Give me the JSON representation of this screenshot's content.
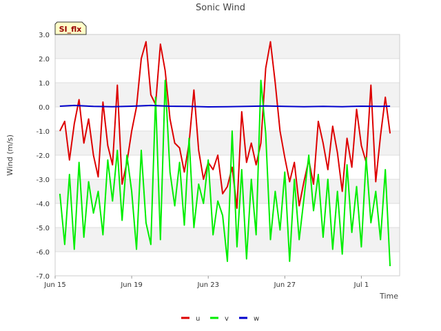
{
  "chart_data": {
    "type": "line",
    "title": "Sonic Wind",
    "xlabel": "Time",
    "ylabel": "Wind (m/s)",
    "badge": "SI_flx",
    "ylim": [
      -7.0,
      3.0
    ],
    "y_ticks": [
      "3.0",
      "2.0",
      "1.0",
      "0.0",
      "-1.0",
      "-2.0",
      "-3.0",
      "-4.0",
      "-5.0",
      "-6.0",
      "-7.0"
    ],
    "xlim": [
      "2023-06-15",
      "2023-07-03"
    ],
    "x_ticks": [
      {
        "date": "2023-06-15",
        "label": "Jun 15"
      },
      {
        "date": "2023-06-19",
        "label": "Jun 19"
      },
      {
        "date": "2023-06-23",
        "label": "Jun 23"
      },
      {
        "date": "2023-06-27",
        "label": "Jun 27"
      },
      {
        "date": "2023-07-01",
        "label": "Jul 1"
      }
    ],
    "grid": true,
    "legend_position": "bottom",
    "series": [
      {
        "name": "u",
        "color": "#dd0000",
        "points": [
          [
            "2023-06-15 06:00",
            -1.0
          ],
          [
            "2023-06-15 12:00",
            -0.6
          ],
          [
            "2023-06-15 18:00",
            -2.2
          ],
          [
            "2023-06-16 00:00",
            -0.7
          ],
          [
            "2023-06-16 06:00",
            0.3
          ],
          [
            "2023-06-16 12:00",
            -1.5
          ],
          [
            "2023-06-16 18:00",
            -0.5
          ],
          [
            "2023-06-17 00:00",
            -2.0
          ],
          [
            "2023-06-17 06:00",
            -2.9
          ],
          [
            "2023-06-17 12:00",
            0.2
          ],
          [
            "2023-06-17 18:00",
            -1.6
          ],
          [
            "2023-06-18 00:00",
            -2.4
          ],
          [
            "2023-06-18 06:00",
            0.9
          ],
          [
            "2023-06-18 12:00",
            -3.2
          ],
          [
            "2023-06-18 18:00",
            -2.3
          ],
          [
            "2023-06-19 00:00",
            -1.0
          ],
          [
            "2023-06-19 06:00",
            0.0
          ],
          [
            "2023-06-19 12:00",
            2.0
          ],
          [
            "2023-06-19 18:00",
            2.7
          ],
          [
            "2023-06-20 00:00",
            0.5
          ],
          [
            "2023-06-20 06:00",
            0.1
          ],
          [
            "2023-06-20 12:00",
            2.6
          ],
          [
            "2023-06-20 18:00",
            1.5
          ],
          [
            "2023-06-21 00:00",
            -0.5
          ],
          [
            "2023-06-21 06:00",
            -1.5
          ],
          [
            "2023-06-21 12:00",
            -1.7
          ],
          [
            "2023-06-21 18:00",
            -2.7
          ],
          [
            "2023-06-22 00:00",
            -1.5
          ],
          [
            "2023-06-22 06:00",
            0.7
          ],
          [
            "2023-06-22 12:00",
            -1.8
          ],
          [
            "2023-06-22 18:00",
            -3.0
          ],
          [
            "2023-06-23 00:00",
            -2.3
          ],
          [
            "2023-06-23 06:00",
            -2.6
          ],
          [
            "2023-06-23 12:00",
            -2.0
          ],
          [
            "2023-06-23 18:00",
            -3.6
          ],
          [
            "2023-06-24 00:00",
            -3.3
          ],
          [
            "2023-06-24 06:00",
            -2.5
          ],
          [
            "2023-06-24 12:00",
            -4.2
          ],
          [
            "2023-06-24 18:00",
            -0.2
          ],
          [
            "2023-06-25 00:00",
            -2.3
          ],
          [
            "2023-06-25 06:00",
            -1.5
          ],
          [
            "2023-06-25 12:00",
            -2.4
          ],
          [
            "2023-06-25 18:00",
            -1.5
          ],
          [
            "2023-06-26 00:00",
            1.6
          ],
          [
            "2023-06-26 06:00",
            2.7
          ],
          [
            "2023-06-26 12:00",
            1.0
          ],
          [
            "2023-06-26 18:00",
            -1.0
          ],
          [
            "2023-06-27 00:00",
            -2.1
          ],
          [
            "2023-06-27 06:00",
            -3.1
          ],
          [
            "2023-06-27 12:00",
            -2.3
          ],
          [
            "2023-06-27 18:00",
            -4.1
          ],
          [
            "2023-06-28 00:00",
            -3.1
          ],
          [
            "2023-06-28 06:00",
            -2.2
          ],
          [
            "2023-06-28 12:00",
            -3.2
          ],
          [
            "2023-06-28 18:00",
            -0.6
          ],
          [
            "2023-06-29 00:00",
            -1.5
          ],
          [
            "2023-06-29 06:00",
            -2.6
          ],
          [
            "2023-06-29 12:00",
            -0.8
          ],
          [
            "2023-06-29 18:00",
            -1.9
          ],
          [
            "2023-06-30 00:00",
            -3.5
          ],
          [
            "2023-06-30 06:00",
            -1.3
          ],
          [
            "2023-06-30 12:00",
            -2.5
          ],
          [
            "2023-06-30 18:00",
            -0.1
          ],
          [
            "2023-07-01 00:00",
            -1.6
          ],
          [
            "2023-07-01 06:00",
            -2.3
          ],
          [
            "2023-07-01 12:00",
            0.9
          ],
          [
            "2023-07-01 18:00",
            -3.1
          ],
          [
            "2023-07-02 00:00",
            -1.2
          ],
          [
            "2023-07-02 06:00",
            0.4
          ],
          [
            "2023-07-02 12:00",
            -1.1
          ]
        ]
      },
      {
        "name": "v",
        "color": "#00ee00",
        "points": [
          [
            "2023-06-15 06:00",
            -3.6
          ],
          [
            "2023-06-15 12:00",
            -5.7
          ],
          [
            "2023-06-15 18:00",
            -2.8
          ],
          [
            "2023-06-16 00:00",
            -5.9
          ],
          [
            "2023-06-16 06:00",
            -2.3
          ],
          [
            "2023-06-16 12:00",
            -5.4
          ],
          [
            "2023-06-16 18:00",
            -3.1
          ],
          [
            "2023-06-17 00:00",
            -4.4
          ],
          [
            "2023-06-17 06:00",
            -3.5
          ],
          [
            "2023-06-17 12:00",
            -5.3
          ],
          [
            "2023-06-17 18:00",
            -2.2
          ],
          [
            "2023-06-18 00:00",
            -3.9
          ],
          [
            "2023-06-18 06:00",
            -1.8
          ],
          [
            "2023-06-18 12:00",
            -4.7
          ],
          [
            "2023-06-18 18:00",
            -2.0
          ],
          [
            "2023-06-19 00:00",
            -3.5
          ],
          [
            "2023-06-19 06:00",
            -5.9
          ],
          [
            "2023-06-19 12:00",
            -1.8
          ],
          [
            "2023-06-19 18:00",
            -4.8
          ],
          [
            "2023-06-20 00:00",
            -5.7
          ],
          [
            "2023-06-20 06:00",
            0.4
          ],
          [
            "2023-06-20 12:00",
            -5.5
          ],
          [
            "2023-06-20 18:00",
            1.1
          ],
          [
            "2023-06-21 00:00",
            -2.7
          ],
          [
            "2023-06-21 06:00",
            -4.1
          ],
          [
            "2023-06-21 12:00",
            -2.3
          ],
          [
            "2023-06-21 18:00",
            -4.9
          ],
          [
            "2023-06-22 00:00",
            -1.3
          ],
          [
            "2023-06-22 06:00",
            -5.0
          ],
          [
            "2023-06-22 12:00",
            -3.2
          ],
          [
            "2023-06-22 18:00",
            -4.0
          ],
          [
            "2023-06-23 00:00",
            -2.2
          ],
          [
            "2023-06-23 06:00",
            -5.3
          ],
          [
            "2023-06-23 12:00",
            -3.9
          ],
          [
            "2023-06-23 18:00",
            -4.5
          ],
          [
            "2023-06-24 00:00",
            -6.4
          ],
          [
            "2023-06-24 06:00",
            -1.0
          ],
          [
            "2023-06-24 12:00",
            -5.8
          ],
          [
            "2023-06-24 18:00",
            -2.6
          ],
          [
            "2023-06-25 00:00",
            -6.3
          ],
          [
            "2023-06-25 06:00",
            -3.0
          ],
          [
            "2023-06-25 12:00",
            -5.3
          ],
          [
            "2023-06-25 18:00",
            1.1
          ],
          [
            "2023-06-26 00:00",
            -1.1
          ],
          [
            "2023-06-26 06:00",
            -5.5
          ],
          [
            "2023-06-26 12:00",
            -3.5
          ],
          [
            "2023-06-26 18:00",
            -5.1
          ],
          [
            "2023-06-27 00:00",
            -2.7
          ],
          [
            "2023-06-27 06:00",
            -6.4
          ],
          [
            "2023-06-27 12:00",
            -3.0
          ],
          [
            "2023-06-27 18:00",
            -5.5
          ],
          [
            "2023-06-28 00:00",
            -3.8
          ],
          [
            "2023-06-28 06:00",
            -2.0
          ],
          [
            "2023-06-28 12:00",
            -4.3
          ],
          [
            "2023-06-28 18:00",
            -2.8
          ],
          [
            "2023-06-29 00:00",
            -5.4
          ],
          [
            "2023-06-29 06:00",
            -3.0
          ],
          [
            "2023-06-29 12:00",
            -5.9
          ],
          [
            "2023-06-29 18:00",
            -3.5
          ],
          [
            "2023-06-30 00:00",
            -6.1
          ],
          [
            "2023-06-30 06:00",
            -2.4
          ],
          [
            "2023-06-30 12:00",
            -5.2
          ],
          [
            "2023-06-30 18:00",
            -3.3
          ],
          [
            "2023-07-01 00:00",
            -5.8
          ],
          [
            "2023-07-01 06:00",
            -2.1
          ],
          [
            "2023-07-01 12:00",
            -4.8
          ],
          [
            "2023-07-01 18:00",
            -3.5
          ],
          [
            "2023-07-02 00:00",
            -5.5
          ],
          [
            "2023-07-02 06:00",
            -2.6
          ],
          [
            "2023-07-02 12:00",
            -6.6
          ]
        ]
      },
      {
        "name": "w",
        "color": "#0000cc",
        "points": [
          [
            "2023-06-15 06:00",
            0.03
          ],
          [
            "2023-06-16 00:00",
            0.06
          ],
          [
            "2023-06-17 00:00",
            0.02
          ],
          [
            "2023-06-18 00:00",
            0.01
          ],
          [
            "2023-06-19 00:00",
            0.03
          ],
          [
            "2023-06-20 00:00",
            0.06
          ],
          [
            "2023-06-21 00:00",
            0.03
          ],
          [
            "2023-06-22 00:00",
            0.02
          ],
          [
            "2023-06-23 00:00",
            0.0
          ],
          [
            "2023-06-24 00:00",
            0.01
          ],
          [
            "2023-06-25 00:00",
            0.02
          ],
          [
            "2023-06-26 00:00",
            0.04
          ],
          [
            "2023-06-27 00:00",
            0.02
          ],
          [
            "2023-06-28 00:00",
            0.01
          ],
          [
            "2023-06-29 00:00",
            0.02
          ],
          [
            "2023-06-30 00:00",
            0.01
          ],
          [
            "2023-07-01 00:00",
            0.03
          ],
          [
            "2023-07-02 00:00",
            0.02
          ],
          [
            "2023-07-02 12:00",
            0.03
          ]
        ]
      }
    ]
  }
}
